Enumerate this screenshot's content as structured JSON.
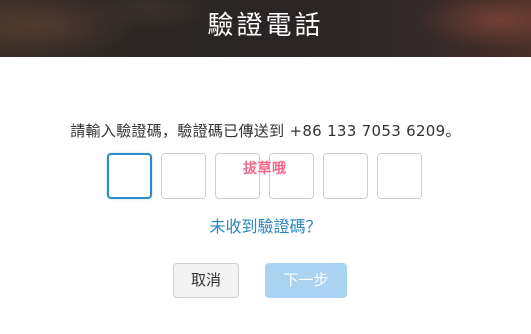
{
  "header": {
    "title": "驗證電話"
  },
  "instruction": "請輸入驗證碼，驗證碼已傳送到 +86 133 7053 6209。",
  "code_inputs": [
    "",
    "",
    "",
    "",
    "",
    ""
  ],
  "watermark": "拔草哦",
  "resend_link": "未收到驗證碼？",
  "buttons": {
    "cancel": "取消",
    "next": "下一步"
  },
  "colors": {
    "link": "#2a87c0",
    "active_border": "#2b8cc4",
    "next_disabled": "#a9d3f1",
    "watermark": "#f06a8a"
  }
}
